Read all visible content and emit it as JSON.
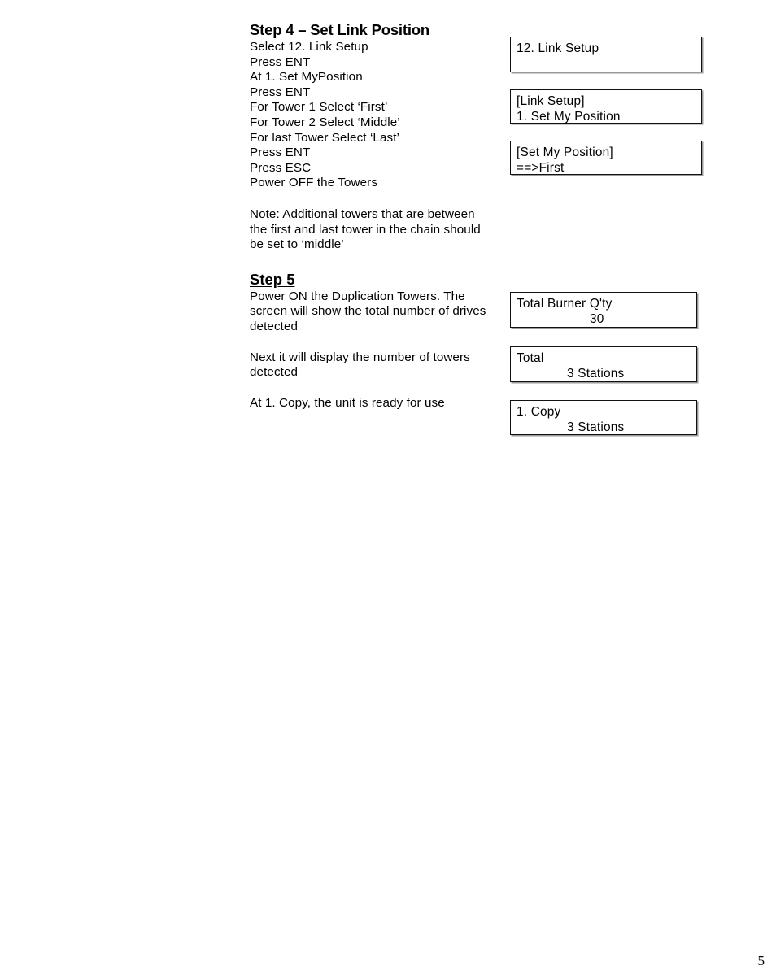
{
  "document": {
    "page_number": "5"
  },
  "step4": {
    "heading": "Step 4 – Set Link Position",
    "lines": [
      "Select 12. Link Setup",
      "Press ENT",
      "At 1. Set MyPosition",
      "Press ENT",
      "For Tower 1 Select ‘First’",
      "For Tower 2 Select ‘Middle’",
      "For last Tower Select ‘Last’",
      "Press ENT",
      "Press ESC",
      "Power OFF the Towers"
    ],
    "note": "Note: Additional towers that are between the first and last tower in the chain should be set to ‘middle’",
    "displays": [
      {
        "name": "link-setup-menu",
        "line1": "12. Link Setup",
        "line2": ""
      },
      {
        "name": "link-setup-submenu",
        "line1": "[Link Setup]",
        "line2": "1. Set My Position"
      },
      {
        "name": "set-my-position",
        "line1": "[Set My Position]",
        "line2": "==>First"
      }
    ]
  },
  "step5": {
    "heading": "Step 5",
    "paragraphs": [
      "Power ON the Duplication Towers.  The screen will show the total number of drives detected",
      "Next it will display the number of towers detected",
      "At 1. Copy, the unit is ready for use"
    ],
    "displays": [
      {
        "name": "total-burner-qty",
        "line1": "Total Burner Q'ty",
        "line2": "30"
      },
      {
        "name": "total-stations",
        "line1": "Total",
        "line2": "3 Stations"
      },
      {
        "name": "copy-ready",
        "line1": "1. Copy",
        "line2": "3 Stations"
      }
    ]
  }
}
